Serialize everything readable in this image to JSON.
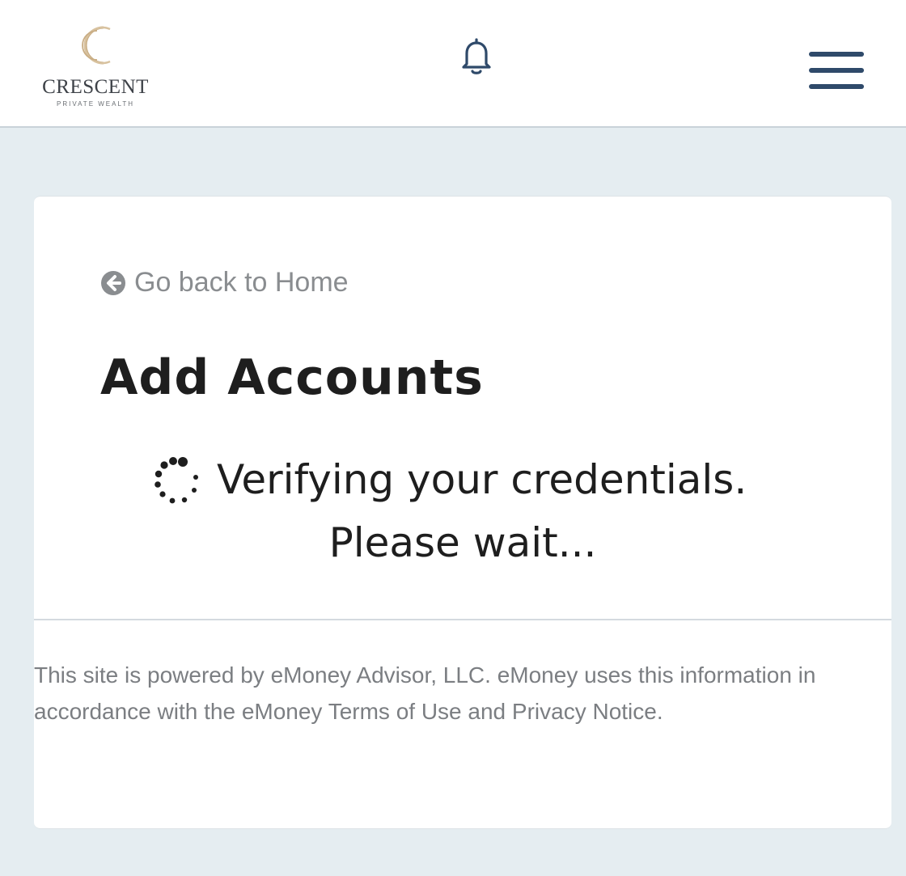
{
  "header": {
    "logo": {
      "wordmark": "CRESCENT",
      "tagline": "PRIVATE WEALTH",
      "icon": "crescent-logo-mark",
      "color": "#c9ad84"
    },
    "notifications_icon": "bell-icon",
    "menu_icon": "hamburger-menu-icon"
  },
  "content": {
    "back_link": {
      "icon": "circle-arrow-left-icon",
      "label": "Go back to Home"
    },
    "title": "Add Accounts",
    "status": {
      "icon": "loading-spinner-icon",
      "line1": "Verifying your credentials.",
      "line2": "Please wait..."
    }
  },
  "footer": {
    "text": "This site is powered by eMoney Advisor, LLC. eMoney uses this information in accordance with the eMoney Terms of Use and Privacy Notice."
  },
  "colors": {
    "page_background": "#e5edf1",
    "header_background": "#ffffff",
    "accent_navy": "#2f4a6a",
    "muted_text": "#8a8d90",
    "heading_text": "#1e1e1e"
  }
}
